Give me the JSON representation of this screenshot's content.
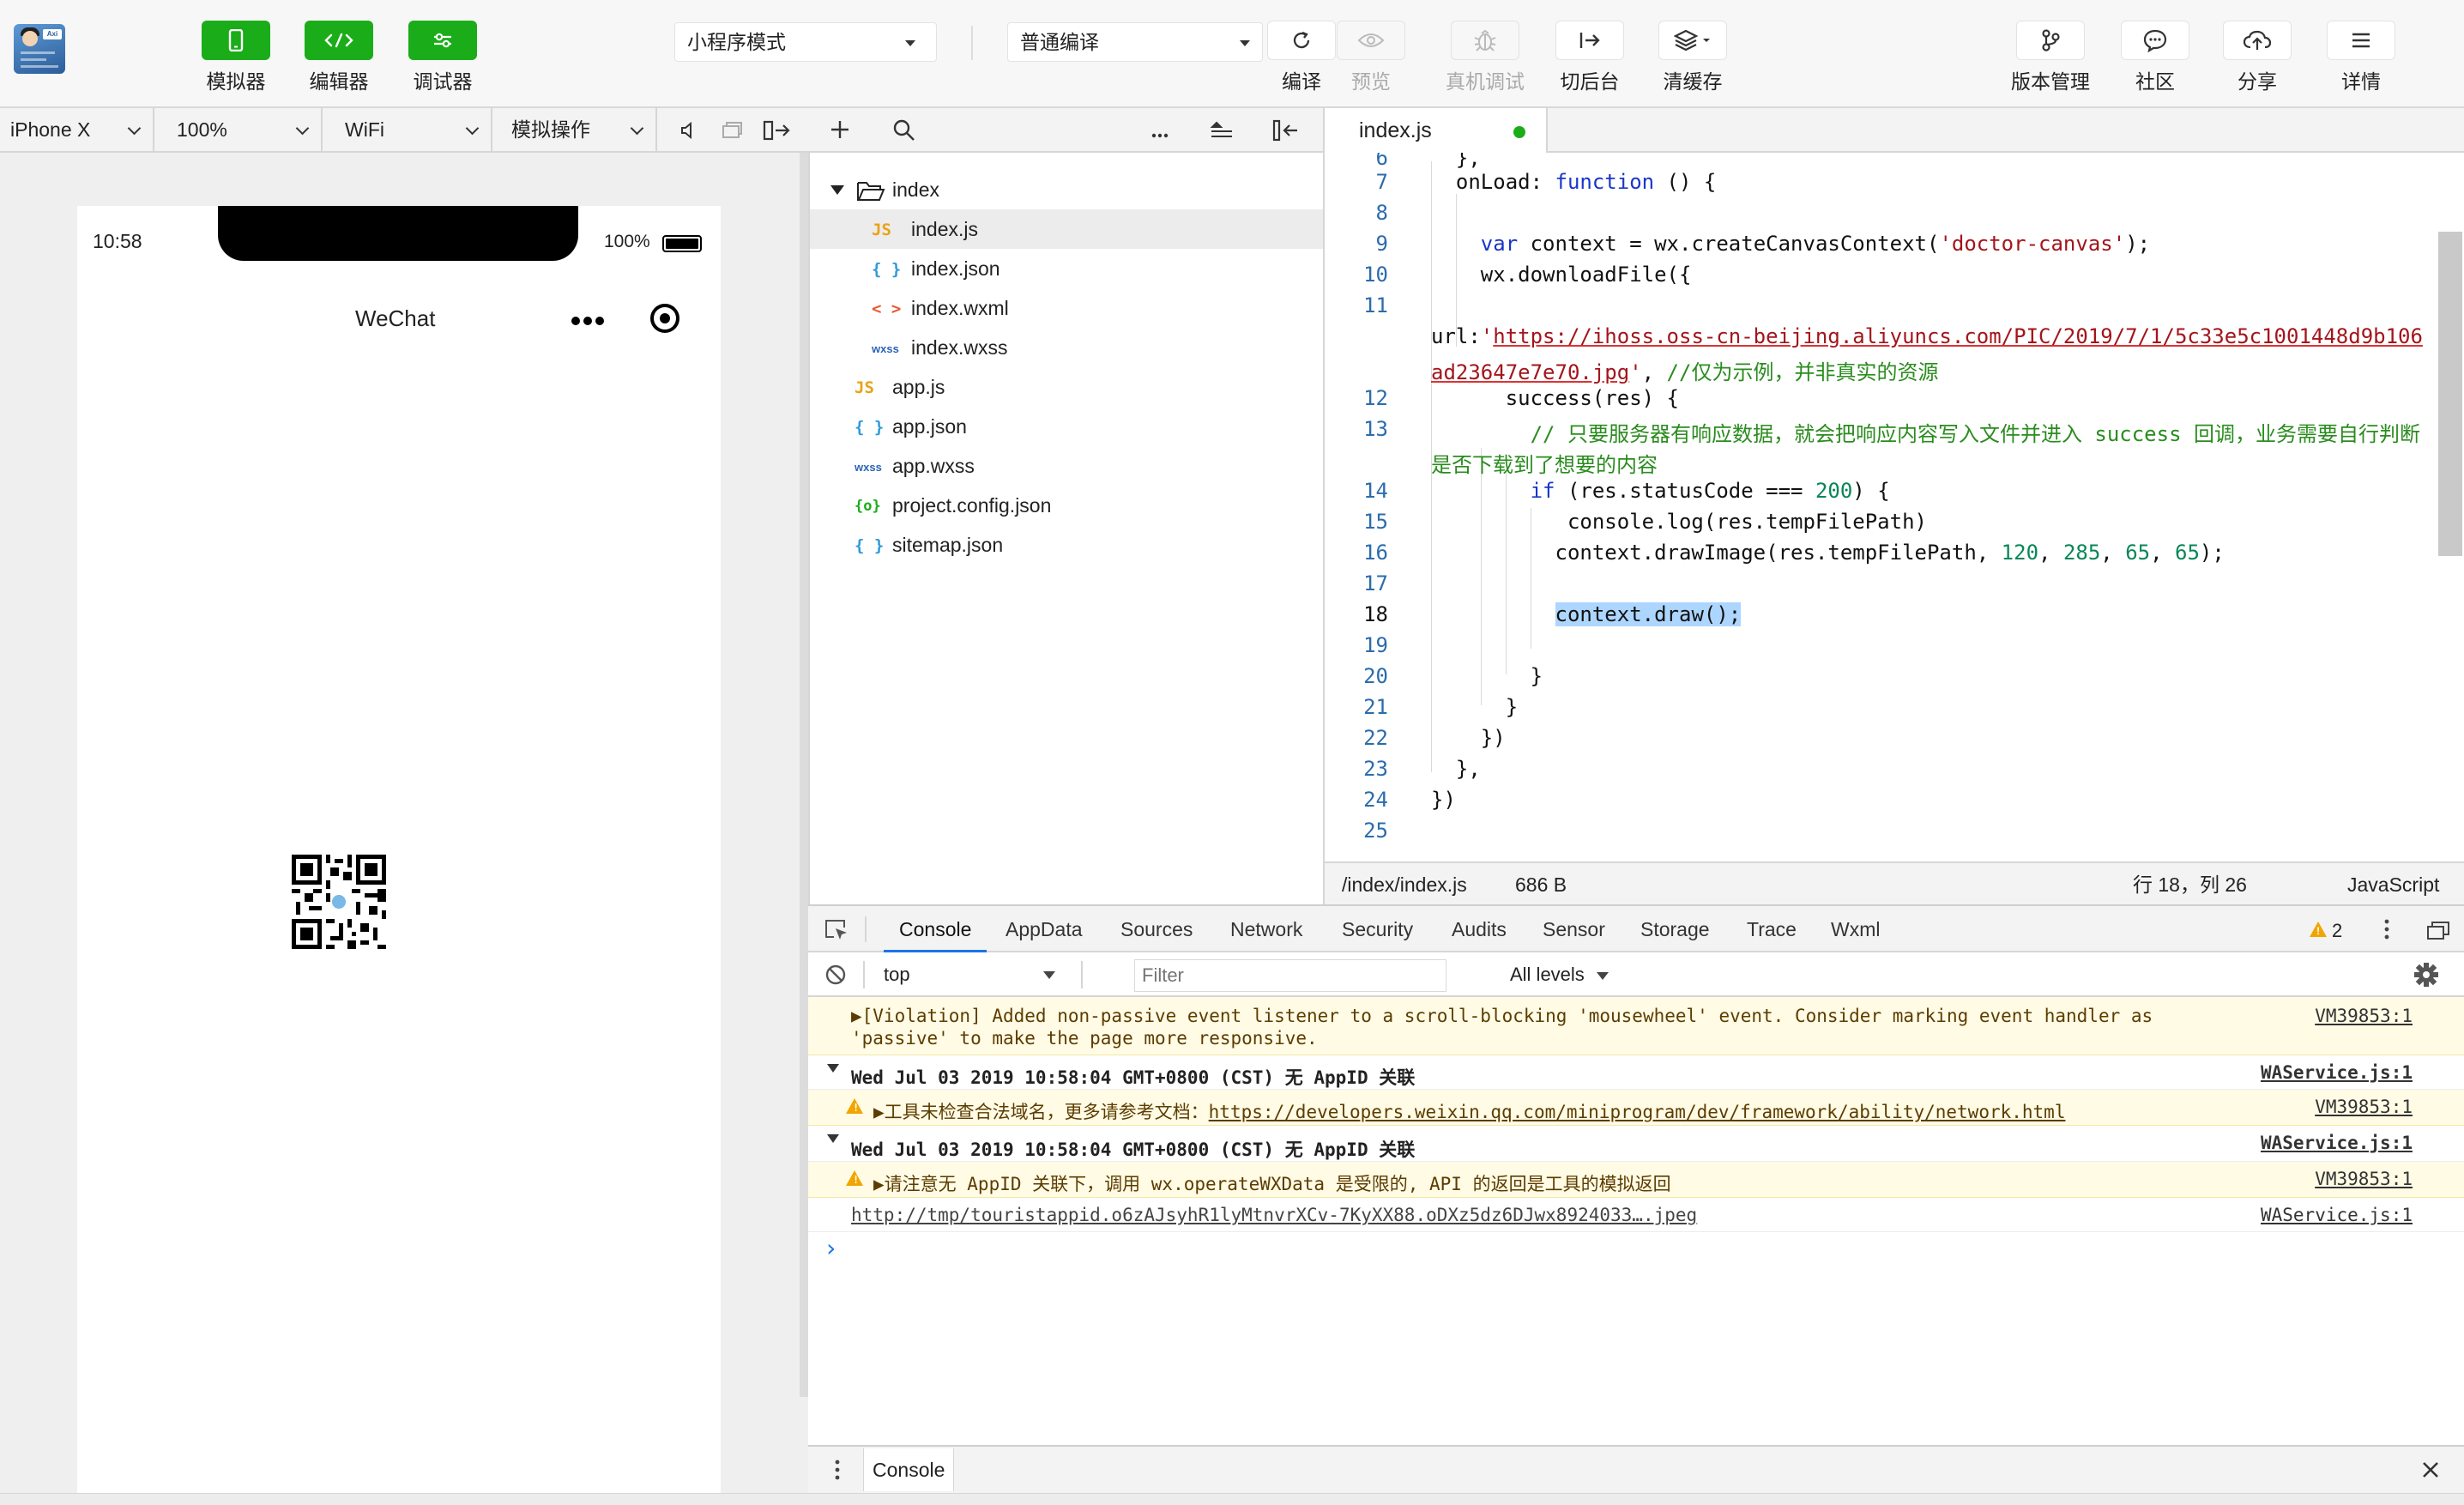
{
  "toolbar": {
    "simulator": "模拟器",
    "editor": "编辑器",
    "debugger": "调试器",
    "mode_select": "小程序模式",
    "compile_select": "普通编译",
    "compile": "编译",
    "preview": "预览",
    "real_device": "真机调试",
    "background": "切后台",
    "clear_cache": "清缓存",
    "version": "版本管理",
    "community": "社区",
    "share": "分享",
    "details": "详情"
  },
  "simbar": {
    "device": "iPhone X",
    "zoom": "100%",
    "network": "WiFi",
    "operation": "模拟操作"
  },
  "phone": {
    "time": "10:58",
    "battery": "100%",
    "title": "WeChat"
  },
  "tree": {
    "folder": "index",
    "files": [
      {
        "icon": "JS",
        "name": "index.js"
      },
      {
        "icon": "{ }",
        "name": "index.json"
      },
      {
        "icon": "< >",
        "name": "index.wxml"
      },
      {
        "icon": "wxss",
        "name": "index.wxss"
      },
      {
        "icon": "JS",
        "name": "app.js"
      },
      {
        "icon": "{ }",
        "name": "app.json"
      },
      {
        "icon": "wxss",
        "name": "app.wxss"
      },
      {
        "icon": "{o}",
        "name": "project.config.json"
      },
      {
        "icon": "{ }",
        "name": "sitemap.json"
      }
    ]
  },
  "editor": {
    "tab": "index.js",
    "lines": [
      "6",
      "7",
      "8",
      "9",
      "10",
      "11",
      "12",
      "13",
      "14",
      "15",
      "16",
      "17",
      "18",
      "19",
      "20",
      "21",
      "22",
      "23",
      "24",
      "25"
    ],
    "status": {
      "path": "/index/index.js",
      "size": "686 B",
      "position": "行 18，列 26",
      "language": "JavaScript"
    }
  },
  "devtools": {
    "tabs": [
      "Console",
      "AppData",
      "Sources",
      "Network",
      "Security",
      "Audits",
      "Sensor",
      "Storage",
      "Trace",
      "Wxml"
    ],
    "warning_count": "2",
    "context": "top",
    "filter_placeholder": "Filter",
    "levels": "All levels",
    "logs": {
      "violation_1": "▶[Violation] Added non-passive event listener to a scroll-blocking 'mousewheel' event. Consider marking event handler as",
      "violation_2": "'passive' to make the page more responsive.",
      "violation_src": "VM39853:1",
      "group1": "Wed Jul 03 2019 10:58:04 GMT+0800 (CST) 无 AppID 关联",
      "group1_src": "WAService.js:1",
      "warn1_prefix": "▶工具未检查合法域名，更多请参考文档：",
      "warn1_link": "https://developers.weixin.qq.com/miniprogram/dev/framework/ability/network.html",
      "warn1_src": "VM39853:1",
      "group2": "Wed Jul 03 2019 10:58:04 GMT+0800 (CST) 无 AppID 关联",
      "group2_src": "WAService.js:1",
      "warn2": "▶请注意无 AppID 关联下，调用 wx.operateWXData 是受限的, API 的返回是工具的模拟返回",
      "warn2_src": "VM39853:1",
      "tmp_link": "http://tmp/touristappid.o6zAJsyhR1lyMtnvrXCv-7KyXX88.oDXz5dz6DJwx8924033….jpeg",
      "tmp_src": "WAService.js:1",
      "prompt": "›"
    },
    "drawer_tab": "Console"
  }
}
